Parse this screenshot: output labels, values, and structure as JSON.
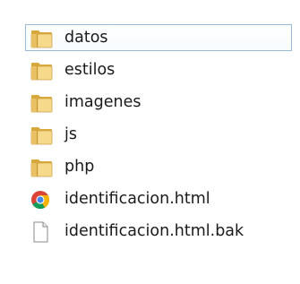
{
  "files": [
    {
      "name": "datos",
      "icon": "folder-icon",
      "selected": true
    },
    {
      "name": "estilos",
      "icon": "folder-icon"
    },
    {
      "name": "imagenes",
      "icon": "folder-icon"
    },
    {
      "name": "js",
      "icon": "folder-icon"
    },
    {
      "name": "php",
      "icon": "folder-icon"
    },
    {
      "name": "identificacion.html",
      "icon": "chrome-html-icon"
    },
    {
      "name": "identificacion.html.bak",
      "icon": "blank-file-icon"
    }
  ],
  "colors": {
    "folder_light": "#f6d98a",
    "folder_dark": "#d8a93a",
    "selection_border": "#99b9d9",
    "chrome_red": "#db4437",
    "chrome_yellow": "#f4b400",
    "chrome_green": "#0f9d58",
    "chrome_blue": "#4285f4"
  }
}
